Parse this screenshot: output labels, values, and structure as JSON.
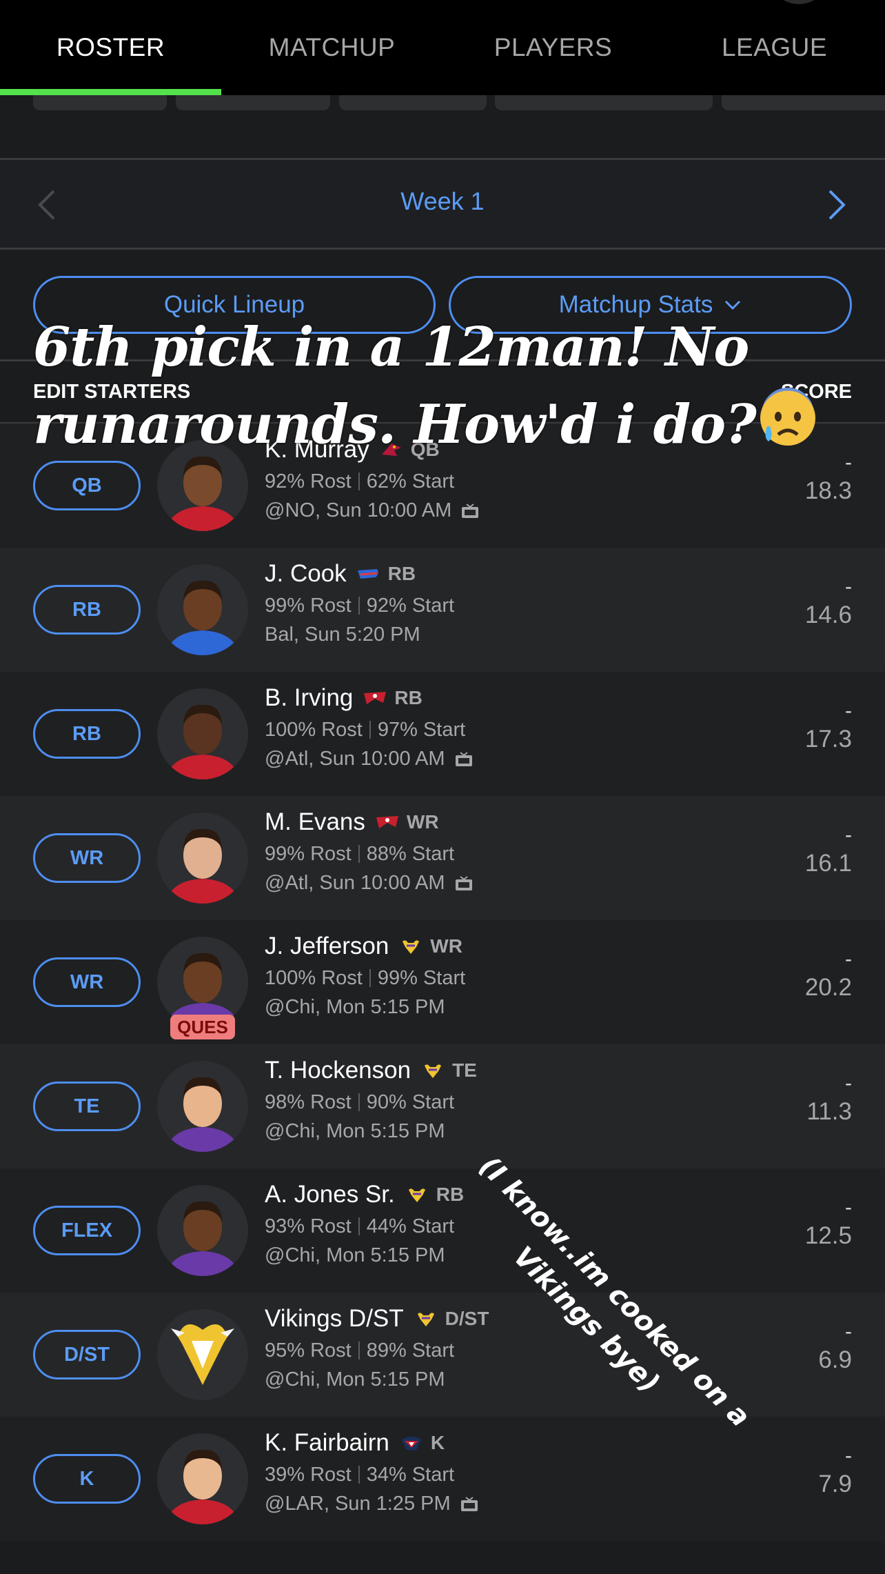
{
  "tabs": [
    {
      "label": "ROSTER",
      "active": true
    },
    {
      "label": "MATCHUP",
      "active": false
    },
    {
      "label": "PLAYERS",
      "active": false
    },
    {
      "label": "LEAGUE",
      "active": false
    }
  ],
  "week": {
    "label": "Week 1"
  },
  "actions": {
    "quick_lineup": "Quick Lineup",
    "matchup_stats": "Matchup Stats"
  },
  "section": {
    "edit_starters": "EDIT STARTERS",
    "score": "SCORE"
  },
  "overlay": {
    "title": "6th pick in a 12man! No runarounds. How'd i do?",
    "note": "(I know..im cooked on a Vikings bye)"
  },
  "roster": [
    {
      "slot": "QB",
      "name": "K. Murray",
      "pos": "QB",
      "team_icon": "cardinals-icon",
      "rost": "92% Rost",
      "start": "62% Start",
      "game": "@NO, Sun 10:00 AM",
      "tv": true,
      "dash": "-",
      "score": "18.3",
      "status": ""
    },
    {
      "slot": "RB",
      "name": "J. Cook",
      "pos": "RB",
      "team_icon": "bills-icon",
      "rost": "99% Rost",
      "start": "92% Start",
      "game": "Bal, Sun 5:20 PM",
      "tv": false,
      "dash": "-",
      "score": "14.6",
      "status": ""
    },
    {
      "slot": "RB",
      "name": "B. Irving",
      "pos": "RB",
      "team_icon": "buccaneers-icon",
      "rost": "100% Rost",
      "start": "97% Start",
      "game": "@Atl, Sun 10:00 AM",
      "tv": true,
      "dash": "-",
      "score": "17.3",
      "status": ""
    },
    {
      "slot": "WR",
      "name": "M. Evans",
      "pos": "WR",
      "team_icon": "buccaneers-icon",
      "rost": "99% Rost",
      "start": "88% Start",
      "game": "@Atl, Sun 10:00 AM",
      "tv": true,
      "dash": "-",
      "score": "16.1",
      "status": ""
    },
    {
      "slot": "WR",
      "name": "J. Jefferson",
      "pos": "WR",
      "team_icon": "vikings-icon",
      "rost": "100% Rost",
      "start": "99% Start",
      "game": "@Chi, Mon 5:15 PM",
      "tv": false,
      "dash": "-",
      "score": "20.2",
      "status": "QUES"
    },
    {
      "slot": "TE",
      "name": "T. Hockenson",
      "pos": "TE",
      "team_icon": "vikings-icon",
      "rost": "98% Rost",
      "start": "90% Start",
      "game": "@Chi, Mon 5:15 PM",
      "tv": false,
      "dash": "-",
      "score": "11.3",
      "status": ""
    },
    {
      "slot": "FLEX",
      "name": "A. Jones Sr.",
      "pos": "RB",
      "team_icon": "vikings-icon",
      "rost": "93% Rost",
      "start": "44% Start",
      "game": "@Chi, Mon 5:15 PM",
      "tv": false,
      "dash": "-",
      "score": "12.5",
      "status": ""
    },
    {
      "slot": "D/ST",
      "name": "Vikings D/ST",
      "pos": "D/ST",
      "team_icon": "vikings-icon",
      "rost": "95% Rost",
      "start": "89% Start",
      "game": "@Chi, Mon 5:15 PM",
      "tv": false,
      "dash": "-",
      "score": "6.9",
      "status": ""
    },
    {
      "slot": "K",
      "name": "K. Fairbairn",
      "pos": "K",
      "team_icon": "texans-icon",
      "rost": "39% Rost",
      "start": "34% Start",
      "game": "@LAR, Sun 1:25 PM",
      "tv": true,
      "dash": "-",
      "score": "7.9",
      "status": ""
    }
  ],
  "colors": {
    "accent": "#5b9cf5",
    "active_tab_underline": "#54e24c",
    "ques_badge": "#f07d7d"
  }
}
